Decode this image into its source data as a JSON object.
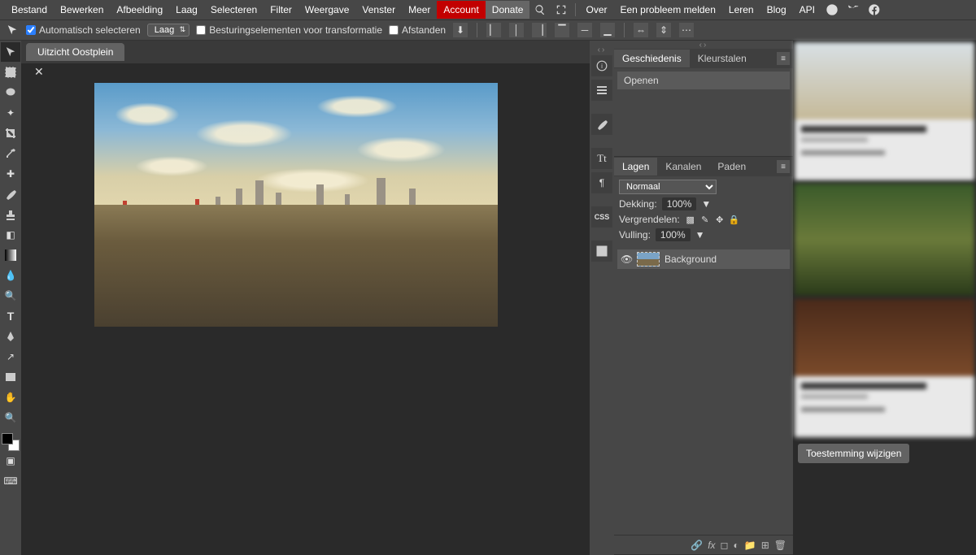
{
  "menu": {
    "items": [
      "Bestand",
      "Bewerken",
      "Afbeelding",
      "Laag",
      "Selecteren",
      "Filter",
      "Weergave",
      "Venster",
      "Meer"
    ],
    "account": "Account",
    "donate": "Donate",
    "over": "Over",
    "report": "Een probleem melden",
    "learn": "Leren",
    "blog": "Blog",
    "api": "API"
  },
  "options": {
    "auto_select": "Automatisch selecteren",
    "layer_select": "Laag",
    "transform_controls": "Besturingselementen voor transformatie",
    "distances": "Afstanden"
  },
  "document": {
    "tab_title": "Uitzicht Oostplein"
  },
  "history_panel": {
    "tab_history": "Geschiedenis",
    "tab_swatches": "Kleurstalen",
    "item_open": "Openen"
  },
  "layers_panel": {
    "tab_layers": "Lagen",
    "tab_channels": "Kanalen",
    "tab_paths": "Paden",
    "blend_mode": "Normaal",
    "opacity_label": "Dekking:",
    "opacity_value": "100%",
    "lock_label": "Vergrendelen:",
    "fill_label": "Vulling:",
    "fill_value": "100%",
    "layer_name": "Background"
  },
  "consent_button": "Toestemming wijzigen"
}
